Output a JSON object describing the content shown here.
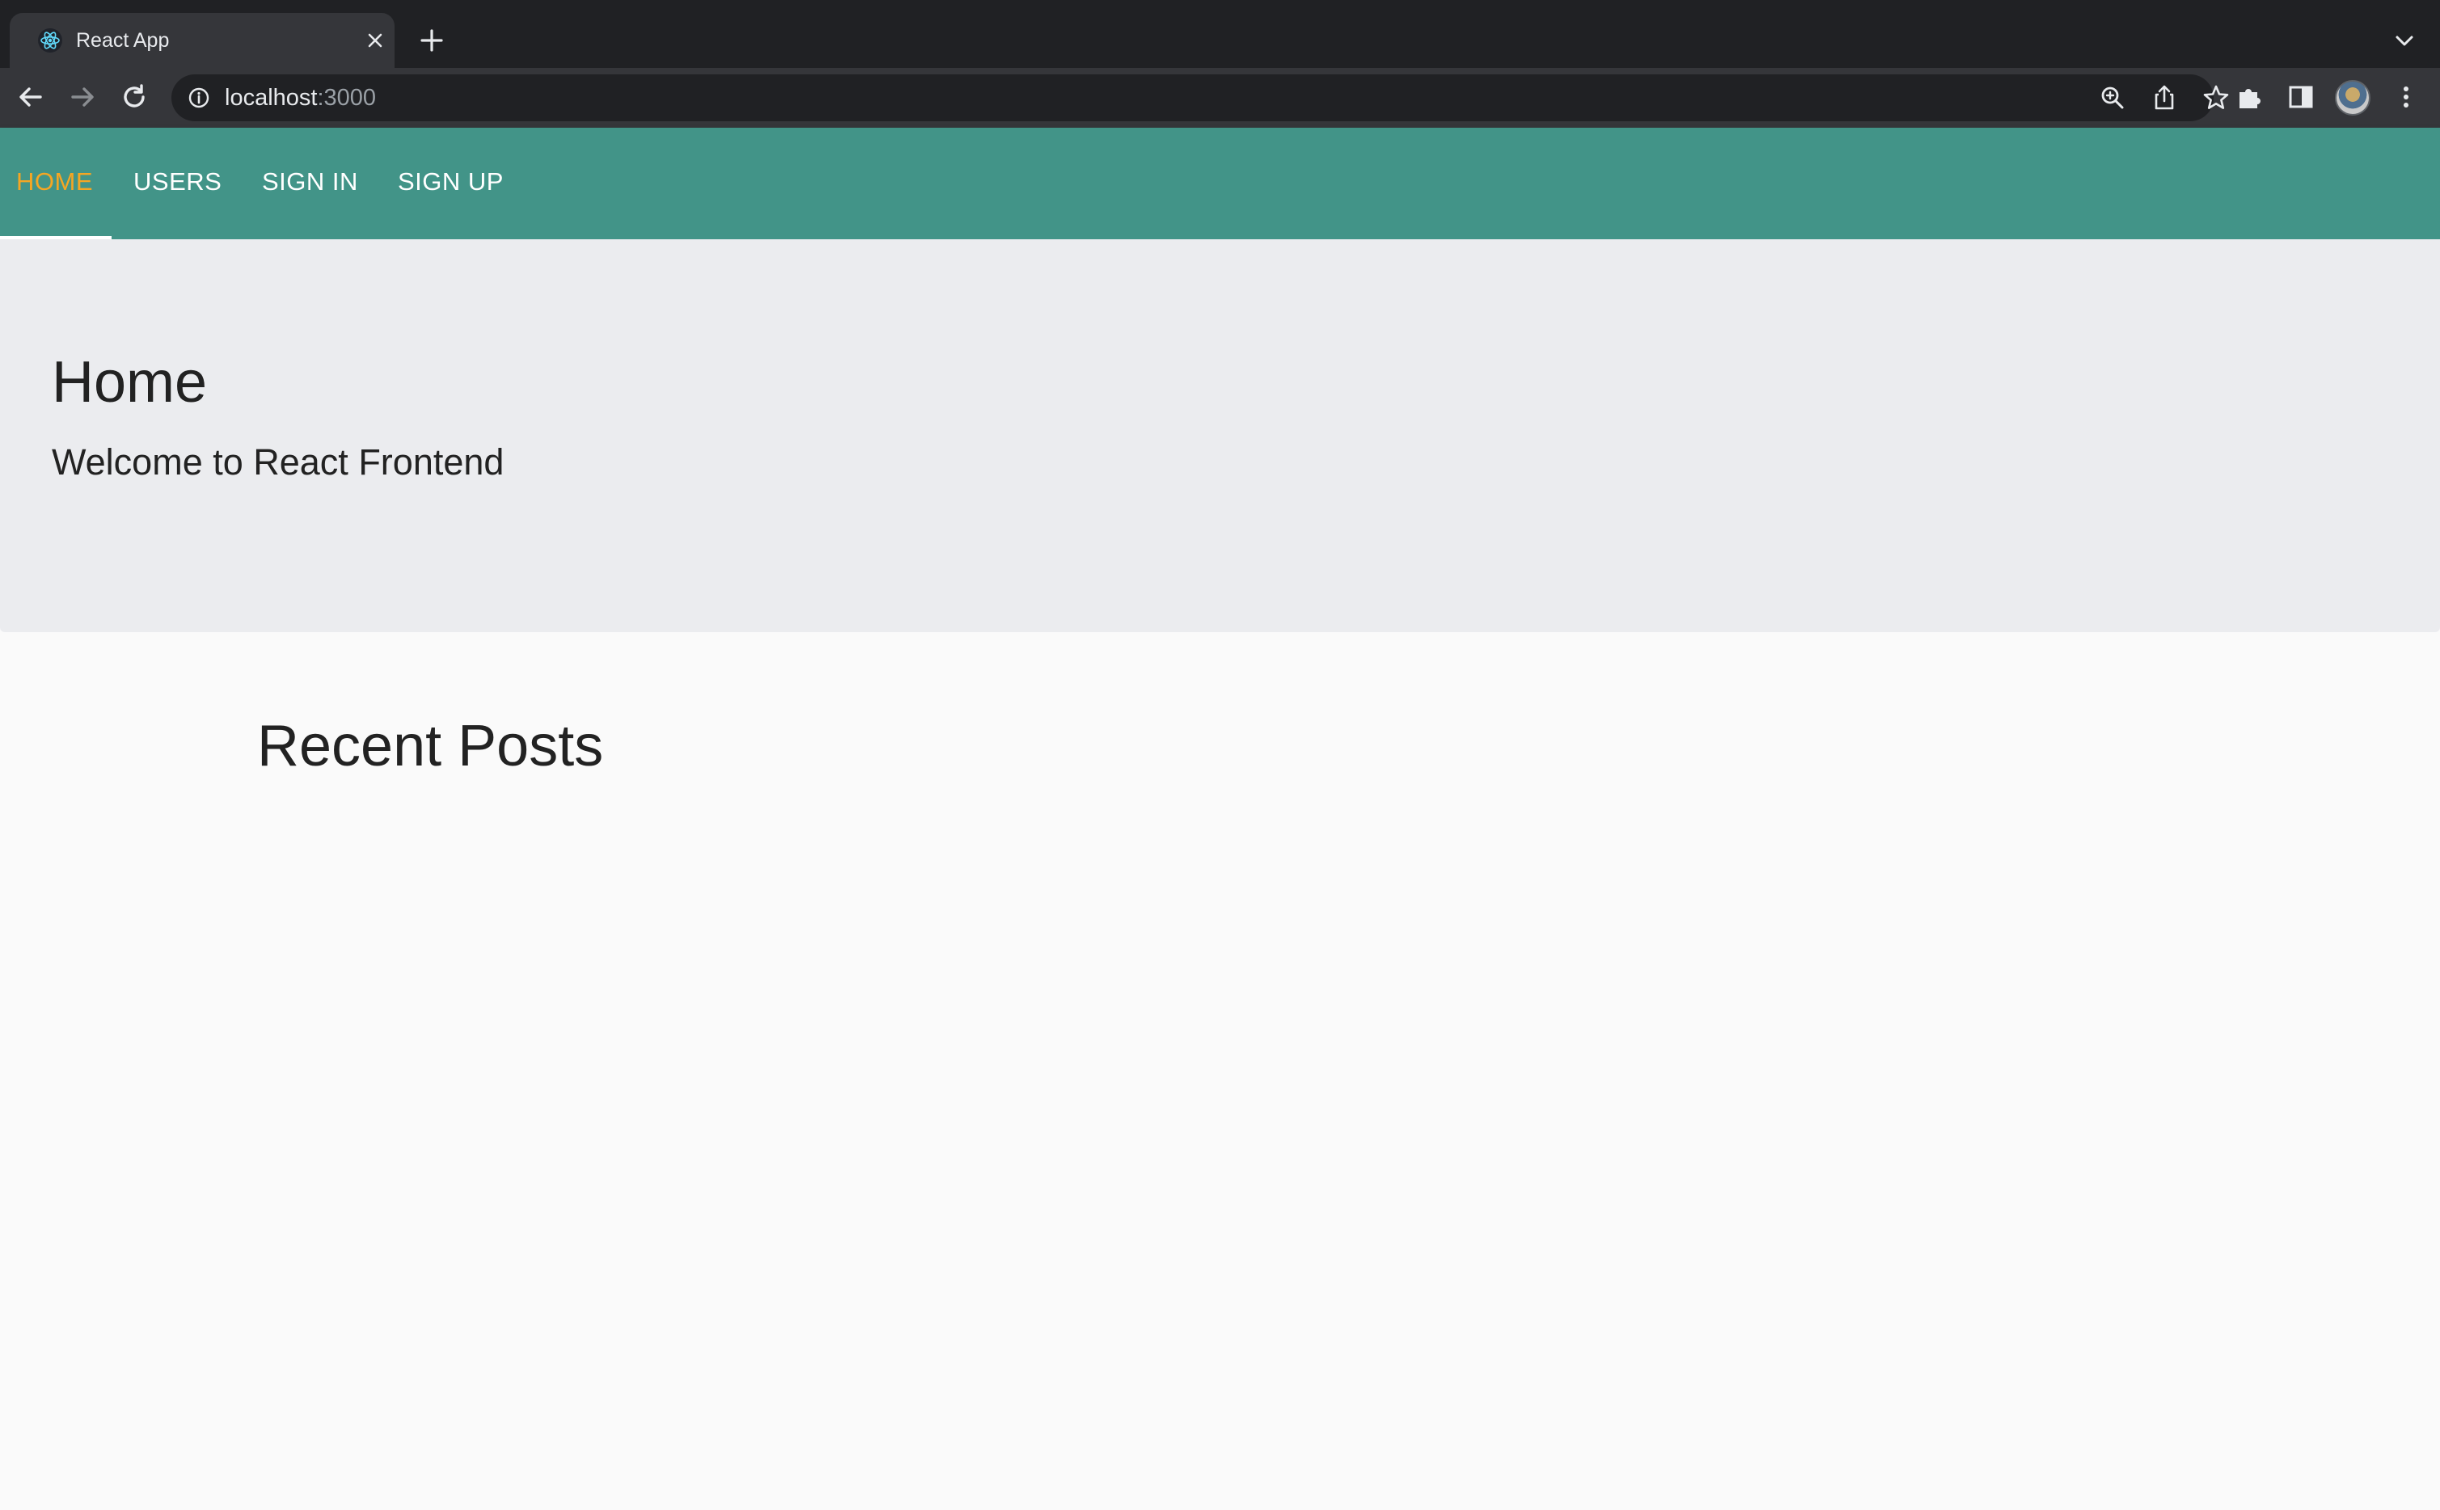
{
  "browser": {
    "tab": {
      "title": "React App",
      "favicon": "react-logo-icon"
    },
    "omnibox": {
      "host": "localhost",
      "port": ":3000"
    },
    "icons": {
      "back": "back-arrow-icon",
      "forward": "forward-arrow-icon",
      "reload": "reload-icon",
      "info": "info-icon",
      "zoom": "zoom-icon",
      "share": "share-icon",
      "bookmark": "star-icon",
      "extensions": "puzzle-icon",
      "side_panel": "side-panel-icon",
      "menu": "kebab-menu-icon"
    }
  },
  "navbar": {
    "items": [
      {
        "label": "HOME",
        "active": true
      },
      {
        "label": "USERS",
        "active": false
      },
      {
        "label": "SIGN IN",
        "active": false
      },
      {
        "label": "SIGN UP",
        "active": false
      }
    ]
  },
  "hero": {
    "title": "Home",
    "subtitle": "Welcome to React Frontend"
  },
  "main": {
    "section_title": "Recent Posts"
  },
  "colors": {
    "navbar_bg": "#429488",
    "active_nav": "#f5a623",
    "hero_bg": "#ebecef",
    "page_bg": "#fafafa",
    "browser_dark": "#202124",
    "browser_toolbar": "#35363a"
  }
}
